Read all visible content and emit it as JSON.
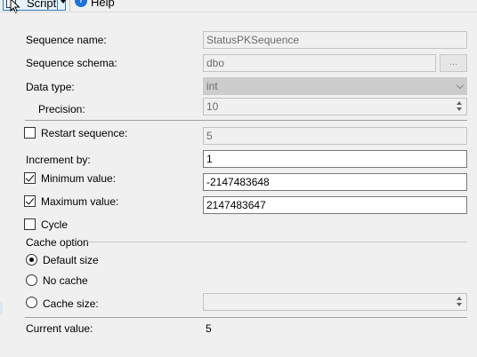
{
  "toolbar": {
    "script_label": "Script",
    "help_label": "Help",
    "script_icon": "script-doc-icon",
    "help_icon": "help-icon"
  },
  "form": {
    "sequence_name": {
      "label": "Sequence name:",
      "value": "StatusPKSequence"
    },
    "sequence_schema": {
      "label": "Sequence schema:",
      "value": "dbo",
      "browse_label": "..."
    },
    "data_type": {
      "label": "Data type:",
      "value": "int"
    },
    "precision": {
      "label": "Precision:",
      "value": "10"
    },
    "restart_sequence": {
      "label": "Restart sequence:",
      "checked": false,
      "value": "5"
    },
    "increment_by": {
      "label": "Increment by:",
      "value": "1"
    },
    "minimum_value": {
      "label": "Minimum value:",
      "checked": true,
      "value": "-2147483648"
    },
    "maximum_value": {
      "label": "Maximum value:",
      "checked": true,
      "value": "2147483647"
    },
    "cycle": {
      "label": "Cycle",
      "checked": false
    },
    "cache_option": {
      "heading": "Cache option",
      "default_size": {
        "label": "Default size",
        "selected": true
      },
      "no_cache": {
        "label": "No cache",
        "selected": false
      },
      "cache_size": {
        "label": "Cache size:",
        "selected": false,
        "value": ""
      }
    },
    "current_value": {
      "label": "Current value:",
      "value": "5"
    }
  },
  "colors": {
    "window_bg": "#f0f0f0",
    "disabled_text": "#6d6d6d",
    "accent": "#3c7fb1",
    "help_blue": "#1e73d8"
  }
}
